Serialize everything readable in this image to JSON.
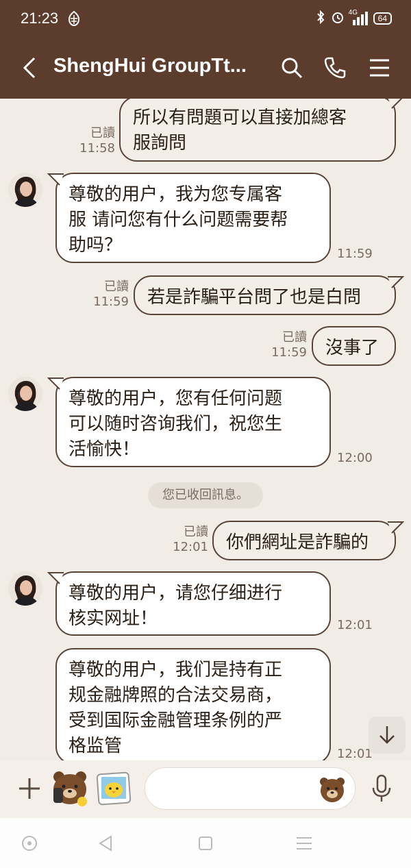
{
  "status_bar": {
    "time": "21:23",
    "network": "4G",
    "battery": "64"
  },
  "header": {
    "title": "ShengHui GroupTt..."
  },
  "messages": [
    {
      "side": "out",
      "read": "已讀",
      "time": "11:58",
      "lines": [
        "所以有問題可以直接加總客",
        "服詢問"
      ]
    },
    {
      "side": "in",
      "time": "11:59",
      "lines": [
        "尊敬的用户，我为您专属客",
        "服 请问您有什么问题需要帮",
        "助吗？"
      ]
    },
    {
      "side": "out",
      "read": "已讀",
      "time": "11:59",
      "lines": [
        "若是詐騙平台問了也是白問"
      ]
    },
    {
      "side": "out",
      "read": "已讀",
      "time": "11:59",
      "lines": [
        "沒事了"
      ]
    },
    {
      "side": "in",
      "time": "12:00",
      "lines": [
        "尊敬的用户，您有任何问题",
        "可以随时咨询我们，祝您生",
        "活愉快！"
      ]
    },
    {
      "side": "out",
      "read": "已讀",
      "time": "12:01",
      "lines": [
        "你們網址是詐騙的"
      ]
    },
    {
      "side": "in",
      "time": "12:01",
      "lines": [
        "尊敬的用户，请您仔细进行",
        "核实网址！"
      ]
    },
    {
      "side": "in",
      "time": "12:01",
      "lines": [
        "尊敬的用户，我们是持有正",
        "规金融牌照的合法交易商，",
        "受到国际金融管理条例的严",
        "格监管"
      ]
    }
  ],
  "notice": "您已收回訊息。",
  "input": {
    "placeholder": ""
  },
  "colors": {
    "header_bg": "#5c3d2d",
    "chat_bg": "#f1ece6",
    "bubble_border": "#594438"
  }
}
